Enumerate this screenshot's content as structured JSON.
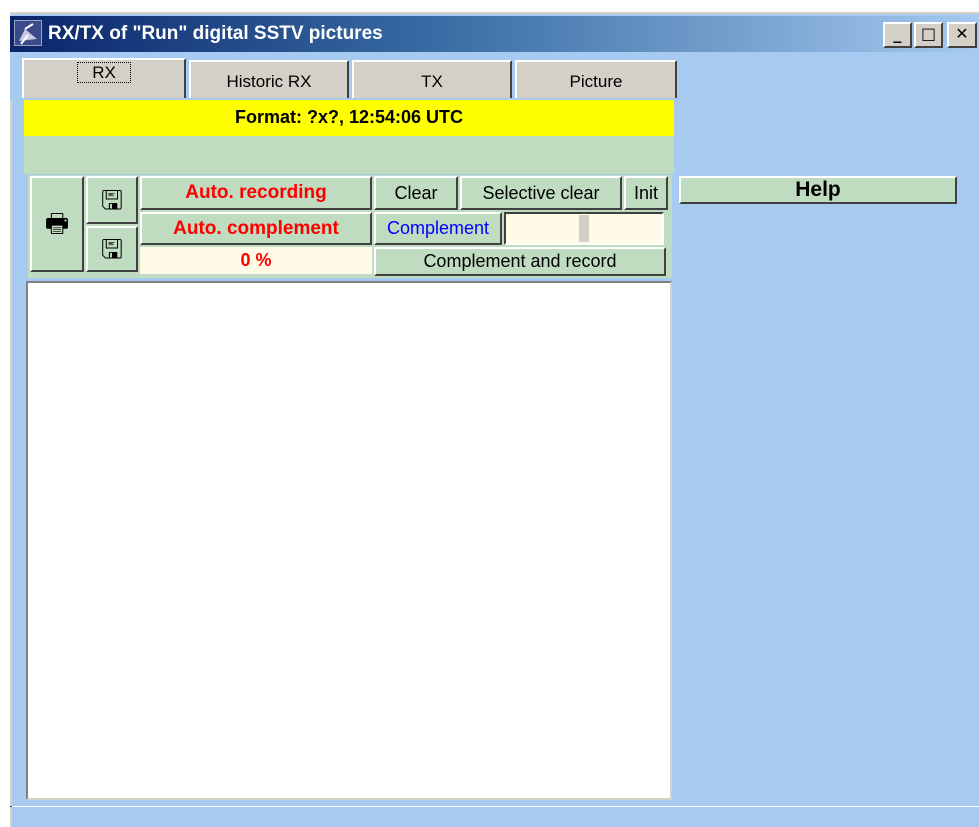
{
  "window": {
    "title": "RX/TX of \"Run\" digital SSTV pictures",
    "caption_buttons": {
      "minimize": "_",
      "maximize": "□",
      "close": "✕"
    }
  },
  "tabs": [
    {
      "label": "RX",
      "selected": true
    },
    {
      "label": "Historic RX",
      "selected": false
    },
    {
      "label": "TX",
      "selected": false
    },
    {
      "label": "Picture",
      "selected": false
    }
  ],
  "status": {
    "format_text": "Format: ?x?,  12:54:06 UTC"
  },
  "toolbar": {
    "print_icon": "printer-icon",
    "save_icon": "floppy-disk-icon",
    "auto_recording": "Auto. recording",
    "auto_complement": "Auto. complement",
    "percent": "0 %",
    "clear": "Clear",
    "selective_clear": "Selective clear",
    "init": "Init",
    "complement": "Complement",
    "complement_record": "Complement and record",
    "help": "Help",
    "complement_progress": 0.5
  },
  "colors": {
    "window_bg": "#a6caf0",
    "status_bg": "#ffff00",
    "toolbar_bg": "#c0dcc0",
    "accent_red": "#ff0000",
    "accent_blue": "#0000ff"
  }
}
